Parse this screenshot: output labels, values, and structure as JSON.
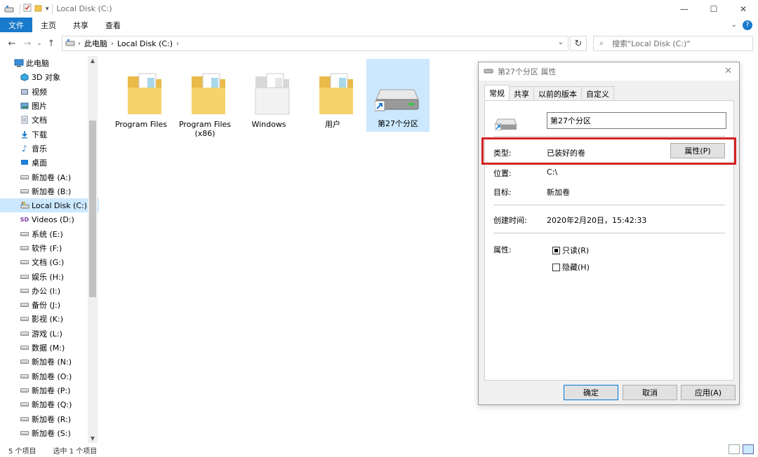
{
  "window": {
    "title": "Local Disk (C:)",
    "controls": [
      "—",
      "☐",
      "✕"
    ]
  },
  "ribbon": {
    "file": "文件",
    "tabs": [
      "主页",
      "共享",
      "查看"
    ]
  },
  "address": {
    "crumbs": [
      "此电脑",
      "Local Disk (C:)"
    ],
    "search_placeholder": "搜索\"Local Disk (C:)\""
  },
  "nav": {
    "items": [
      {
        "label": "此电脑",
        "icon": "pc-icon"
      },
      {
        "label": "3D 对象",
        "icon": "3d-objects-icon"
      },
      {
        "label": "视频",
        "icon": "videos-icon"
      },
      {
        "label": "图片",
        "icon": "pictures-icon"
      },
      {
        "label": "文档",
        "icon": "documents-icon"
      },
      {
        "label": "下载",
        "icon": "downloads-icon"
      },
      {
        "label": "音乐",
        "icon": "music-icon"
      },
      {
        "label": "桌面",
        "icon": "desktop-icon"
      },
      {
        "label": "新加卷 (A:)",
        "icon": "drive-icon"
      },
      {
        "label": "新加卷 (B:)",
        "icon": "drive-icon"
      },
      {
        "label": "Local Disk (C:)",
        "icon": "system-drive-icon"
      },
      {
        "label": "Videos (D:)",
        "icon": "sd-drive-icon"
      },
      {
        "label": "系统 (E:)",
        "icon": "drive-icon"
      },
      {
        "label": "软件 (F:)",
        "icon": "drive-icon"
      },
      {
        "label": "文档 (G:)",
        "icon": "drive-icon"
      },
      {
        "label": "娱乐 (H:)",
        "icon": "drive-icon"
      },
      {
        "label": "办公 (I:)",
        "icon": "drive-icon"
      },
      {
        "label": "备份 (J:)",
        "icon": "drive-icon"
      },
      {
        "label": "影视 (K:)",
        "icon": "drive-icon"
      },
      {
        "label": "游戏 (L:)",
        "icon": "drive-icon"
      },
      {
        "label": "数据 (M:)",
        "icon": "drive-icon"
      },
      {
        "label": "新加卷 (N:)",
        "icon": "drive-icon"
      },
      {
        "label": "新加卷 (O:)",
        "icon": "drive-icon"
      },
      {
        "label": "新加卷 (P:)",
        "icon": "drive-icon"
      },
      {
        "label": "新加卷 (Q:)",
        "icon": "drive-icon"
      },
      {
        "label": "新加卷 (R:)",
        "icon": "drive-icon"
      },
      {
        "label": "新加卷 (S:)",
        "icon": "drive-icon"
      }
    ]
  },
  "files": [
    {
      "name": "Program Files",
      "type": "folder"
    },
    {
      "name": "Program Files (x86)",
      "type": "folder"
    },
    {
      "name": "Windows",
      "type": "folder-white"
    },
    {
      "name": "用户",
      "type": "folder"
    },
    {
      "name": "第27个分区",
      "type": "drive-shortcut"
    }
  ],
  "status": {
    "count": "5 个项目",
    "selected": "选中 1 个项目"
  },
  "dialog": {
    "title": "第27个分区 属性",
    "tabs": [
      "常规",
      "共享",
      "以前的版本",
      "自定义"
    ],
    "name_value": "第27个分区",
    "type_label": "类型:",
    "type_value": "已装好的卷",
    "properties_button": "属性(P)",
    "location_label": "位置:",
    "location_value": "C:\\",
    "target_label": "目标:",
    "target_value": "新加卷",
    "created_label": "创建时间:",
    "created_value": "2020年2月20日，15:42:33",
    "attributes_label": "属性:",
    "readonly_label": "只读(R)",
    "hidden_label": "隐藏(H)",
    "ok": "确定",
    "cancel": "取消",
    "apply": "应用(A)"
  },
  "colors": {
    "accent": "#1979ca",
    "selection": "#cce8ff",
    "highlight_border": "#d42222"
  }
}
